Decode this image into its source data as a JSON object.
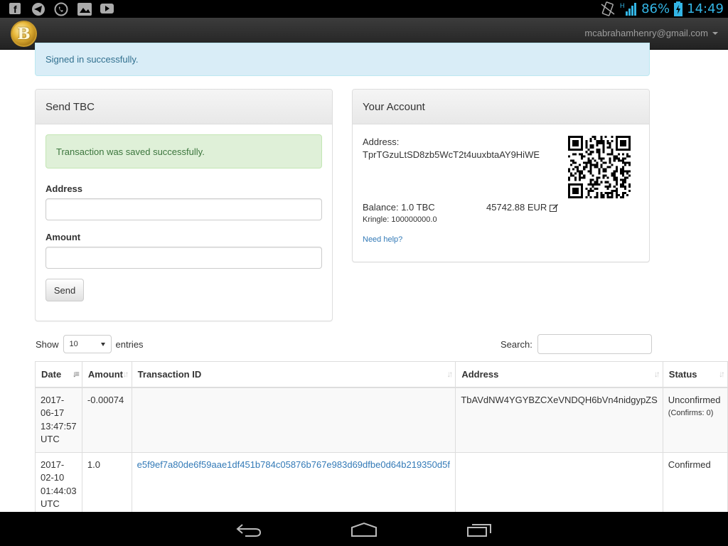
{
  "status_bar": {
    "battery": "86%",
    "time": "14:49",
    "signal": "H"
  },
  "navbar": {
    "logo_letter": "B",
    "user_email": "mcabrahamhenry@gmail.com"
  },
  "flash": {
    "message": "Signed in successfully."
  },
  "send_panel": {
    "title": "Send TBC",
    "success": "Transaction was saved successfully.",
    "address_label": "Address",
    "amount_label": "Amount",
    "send_label": "Send"
  },
  "account_panel": {
    "title": "Your Account",
    "address_label": "Address:",
    "address_value": "TprTGzuLtSD8zb5WcT2t4uuxbtaAY9HiWE",
    "balance": "Balance: 1.0 TBC",
    "eur": "45742.88 EUR",
    "kringle": "Kringle: 100000000.0",
    "help": "Need help?"
  },
  "table_controls": {
    "show": "Show",
    "entries_value": "10",
    "entries": "entries",
    "search": "Search:"
  },
  "table": {
    "headers": [
      "Date",
      "Amount",
      "Transaction ID",
      "Address",
      "Status"
    ],
    "rows": [
      {
        "date": "2017-06-17 13:47:57 UTC",
        "amount": "-0.00074",
        "txid": "",
        "address": "TbAVdNW4YGYBZCXeVNDQH6bVn4nidgypZS",
        "status": "Unconfirmed",
        "confirms": "(Confirms: 0)"
      },
      {
        "date": "2017-02-10 01:44:03 UTC",
        "amount": "1.0",
        "txid": "e5f9ef7a80de6f59aae1df451b784c05876b767e983d69dfbe0d64b219350d5f",
        "address": "",
        "status": "Confirmed",
        "confirms": ""
      }
    ]
  },
  "colors": {
    "info_bg": "#d9edf7",
    "success_bg": "#dff0d8",
    "link": "#337ab7",
    "android_blue": "#33b5e5"
  }
}
